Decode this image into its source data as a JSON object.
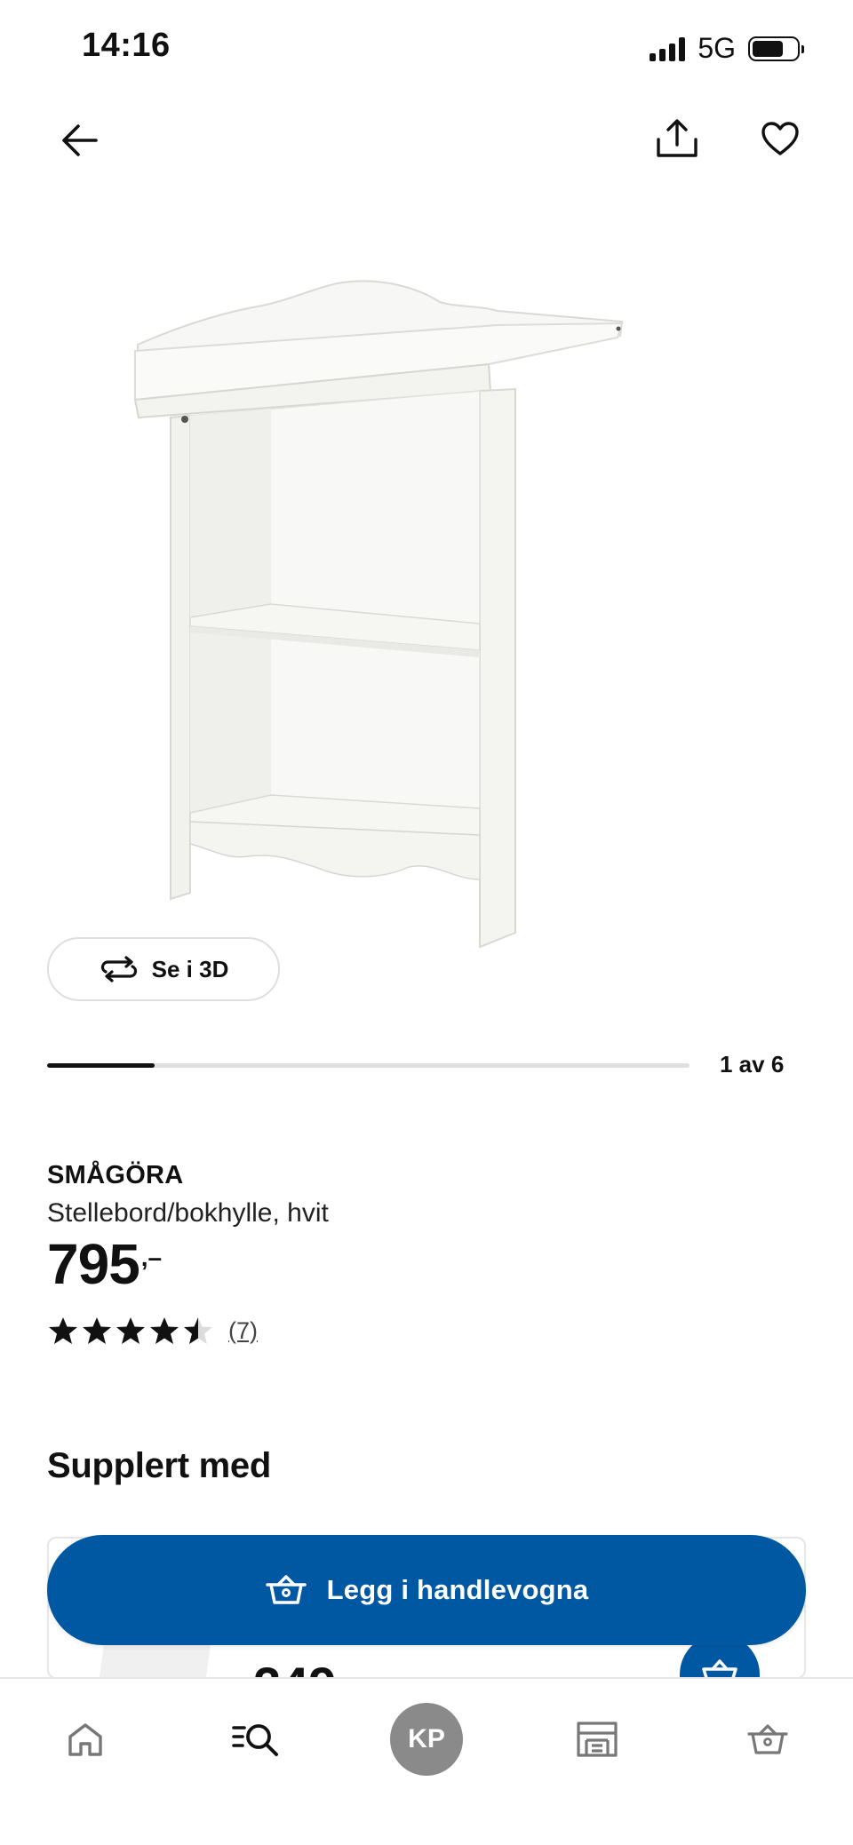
{
  "status_bar": {
    "time": "14:16",
    "network": "5G",
    "battery_level": 0.7
  },
  "top_nav": {
    "back_icon": "arrow-left-icon",
    "share_icon": "share-icon",
    "favorite_icon": "heart-icon"
  },
  "gallery": {
    "view_3d_label": "Se i 3D",
    "current_image": 1,
    "total_images": 6,
    "counter_label": "1 av 6",
    "progress": 0.167
  },
  "product": {
    "name": "SMÅGÖRA",
    "description": "Stellebord/bokhylle, hvit",
    "price_integer": "795",
    "price_decimal": ",–",
    "rating": 4.5,
    "rating_max": 5,
    "review_count_label": "(7)"
  },
  "supplement": {
    "title": "Supplert med",
    "card_price_partial": "249"
  },
  "add_to_cart": {
    "label": "Legg i handlevogna"
  },
  "tab_bar": {
    "tabs": [
      {
        "name": "home",
        "icon": "home-icon"
      },
      {
        "name": "search",
        "icon": "search-list-icon"
      },
      {
        "name": "profile",
        "initials": "KP"
      },
      {
        "name": "store",
        "icon": "store-icon"
      },
      {
        "name": "cart",
        "icon": "basket-icon"
      }
    ]
  },
  "colors": {
    "primary_blue": "#0058a3",
    "text": "#111111",
    "avatar_gray": "#8a8a8a"
  }
}
